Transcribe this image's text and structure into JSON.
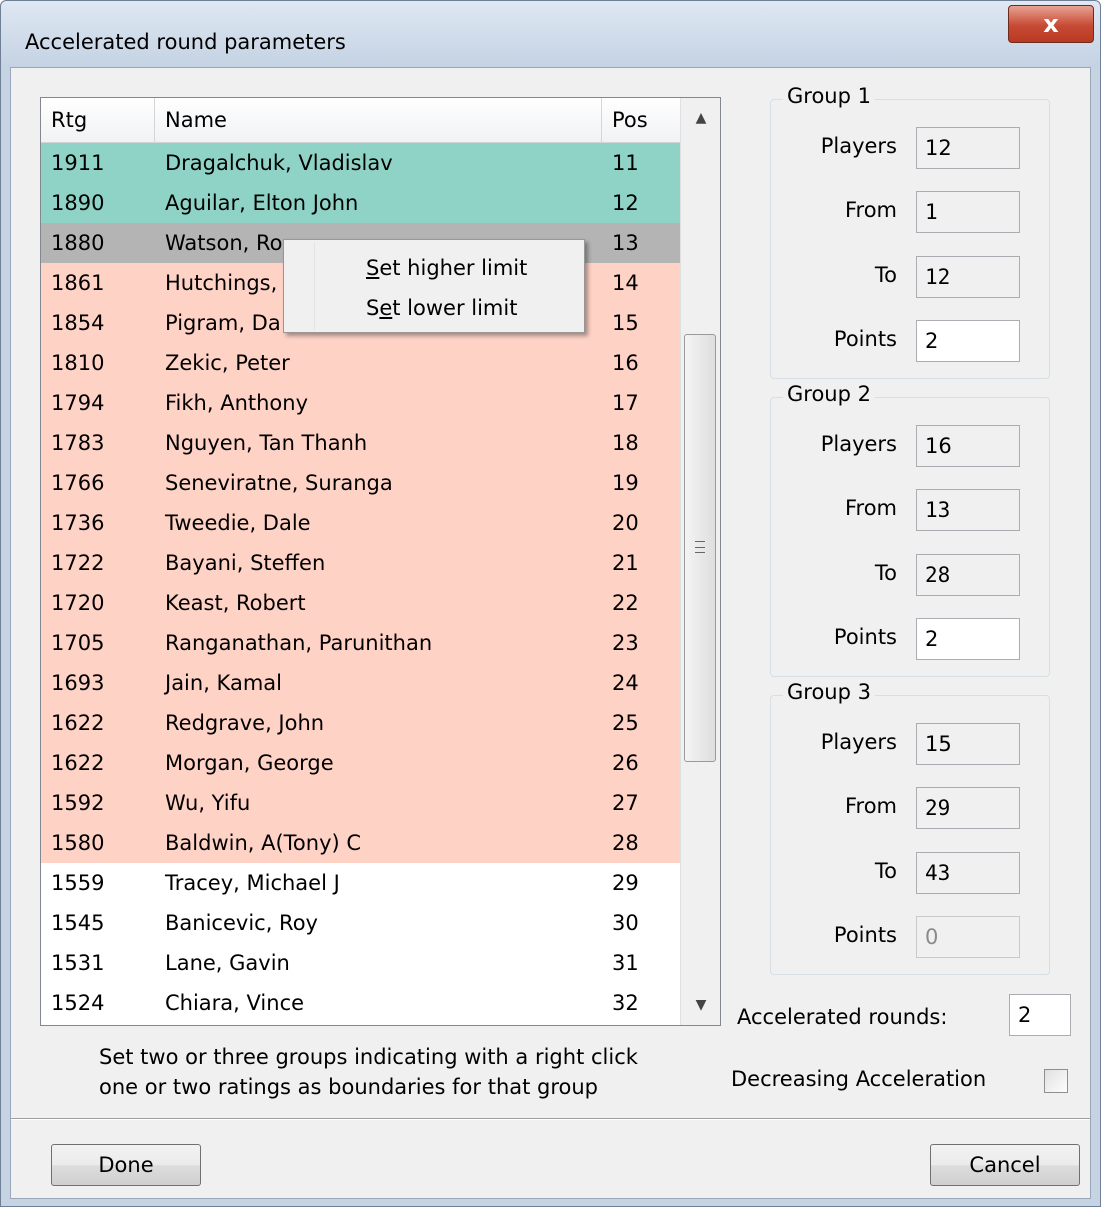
{
  "window": {
    "title": "Accelerated round parameters",
    "close_glyph": "x"
  },
  "list": {
    "columns": [
      "Rtg",
      "Name",
      "Pos"
    ],
    "rows": [
      {
        "rtg": "1911",
        "name": "Dragalchuk, Vladislav",
        "pos": "11",
        "group": "g1"
      },
      {
        "rtg": "1890",
        "name": "Aguilar, Elton John",
        "pos": "12",
        "group": "g1"
      },
      {
        "rtg": "1880",
        "name": "Watson, Ro",
        "pos": "13",
        "group": "sel"
      },
      {
        "rtg": "1861",
        "name": "Hutchings,",
        "pos": "14",
        "group": "g2"
      },
      {
        "rtg": "1854",
        "name": "Pigram, Da",
        "pos": "15",
        "group": "g2"
      },
      {
        "rtg": "1810",
        "name": "Zekic, Peter",
        "pos": "16",
        "group": "g2"
      },
      {
        "rtg": "1794",
        "name": "Fikh, Anthony",
        "pos": "17",
        "group": "g2"
      },
      {
        "rtg": "1783",
        "name": "Nguyen, Tan Thanh",
        "pos": "18",
        "group": "g2"
      },
      {
        "rtg": "1766",
        "name": "Seneviratne, Suranga",
        "pos": "19",
        "group": "g2"
      },
      {
        "rtg": "1736",
        "name": "Tweedie, Dale",
        "pos": "20",
        "group": "g2"
      },
      {
        "rtg": "1722",
        "name": "Bayani, Steffen",
        "pos": "21",
        "group": "g2"
      },
      {
        "rtg": "1720",
        "name": "Keast, Robert",
        "pos": "22",
        "group": "g2"
      },
      {
        "rtg": "1705",
        "name": "Ranganathan, Parunithan",
        "pos": "23",
        "group": "g2"
      },
      {
        "rtg": "1693",
        "name": "Jain, Kamal",
        "pos": "24",
        "group": "g2"
      },
      {
        "rtg": "1622",
        "name": "Redgrave, John",
        "pos": "25",
        "group": "g2"
      },
      {
        "rtg": "1622",
        "name": "Morgan, George",
        "pos": "26",
        "group": "g2"
      },
      {
        "rtg": "1592",
        "name": "Wu, Yifu",
        "pos": "27",
        "group": "g2"
      },
      {
        "rtg": "1580",
        "name": "Baldwin, A(Tony) C",
        "pos": "28",
        "group": "g2"
      },
      {
        "rtg": "1559",
        "name": "Tracey, Michael J",
        "pos": "29",
        "group": "g3"
      },
      {
        "rtg": "1545",
        "name": "Banicevic, Roy",
        "pos": "30",
        "group": "g3"
      },
      {
        "rtg": "1531",
        "name": "Lane, Gavin",
        "pos": "31",
        "group": "g3"
      },
      {
        "rtg": "1524",
        "name": "Chiara, Vince",
        "pos": "32",
        "group": "g3"
      }
    ],
    "group_colors": {
      "g1": "#8ed3c6",
      "g2": "#ffd2c6",
      "sel": "#b4b4b4",
      "g3": "#ffffff"
    }
  },
  "context_menu": {
    "items": [
      {
        "prefix": "",
        "accel": "S",
        "rest": "et higher limit"
      },
      {
        "prefix": "S",
        "accel": "e",
        "rest": "t lower limit"
      }
    ]
  },
  "groups": [
    {
      "title": "Group 1",
      "players_label": "Players",
      "players": "12",
      "from_label": "From",
      "from": "1",
      "to_label": "To",
      "to": "12",
      "points_label": "Points",
      "points": "2"
    },
    {
      "title": "Group 2",
      "players_label": "Players",
      "players": "16",
      "from_label": "From",
      "from": "13",
      "to_label": "To",
      "to": "28",
      "points_label": "Points",
      "points": "2"
    },
    {
      "title": "Group 3",
      "players_label": "Players",
      "players": "15",
      "from_label": "From",
      "from": "29",
      "to_label": "To",
      "to": "43",
      "points_label": "Points",
      "points": "0"
    }
  ],
  "hint": {
    "line1": "Set two or three groups indicating  with a right click",
    "line2": "one or two ratings as boundaries for that group"
  },
  "accelerated_rounds": {
    "label": "Accelerated rounds:",
    "value": "2"
  },
  "decreasing_acceleration": {
    "label": "Decreasing Acceleration",
    "checked": false
  },
  "buttons": {
    "done": "Done",
    "cancel": "Cancel"
  }
}
